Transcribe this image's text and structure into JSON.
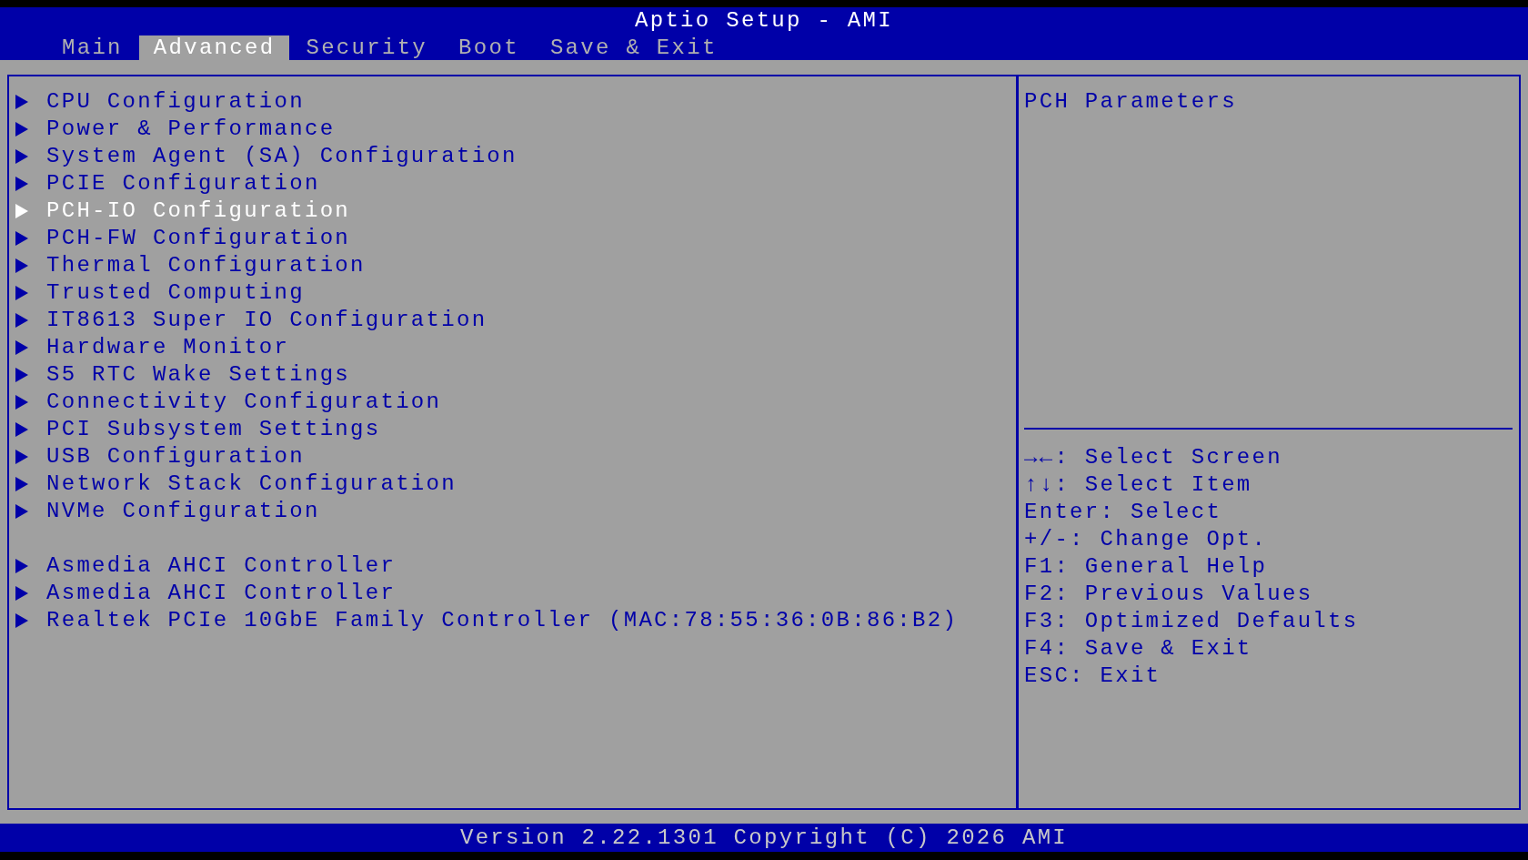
{
  "header": {
    "title": "Aptio Setup - AMI"
  },
  "tabs": [
    {
      "label": "Main",
      "selected": false
    },
    {
      "label": "Advanced",
      "selected": true
    },
    {
      "label": "Security",
      "selected": false
    },
    {
      "label": "Boot",
      "selected": false
    },
    {
      "label": "Save & Exit",
      "selected": false
    }
  ],
  "menu_groups": [
    {
      "items": [
        {
          "label": "CPU Configuration",
          "selected": false
        },
        {
          "label": "Power & Performance",
          "selected": false
        },
        {
          "label": "System Agent (SA) Configuration",
          "selected": false
        },
        {
          "label": "PCIE Configuration",
          "selected": false
        },
        {
          "label": "PCH-IO Configuration",
          "selected": true
        },
        {
          "label": "PCH-FW Configuration",
          "selected": false
        },
        {
          "label": "Thermal Configuration",
          "selected": false
        },
        {
          "label": "Trusted Computing",
          "selected": false
        },
        {
          "label": "IT8613 Super IO Configuration",
          "selected": false
        },
        {
          "label": "Hardware Monitor",
          "selected": false
        },
        {
          "label": "S5 RTC Wake Settings",
          "selected": false
        },
        {
          "label": "Connectivity Configuration",
          "selected": false
        },
        {
          "label": "PCI Subsystem Settings",
          "selected": false
        },
        {
          "label": "USB Configuration",
          "selected": false
        },
        {
          "label": "Network Stack Configuration",
          "selected": false
        },
        {
          "label": "NVMe Configuration",
          "selected": false
        }
      ]
    },
    {
      "items": [
        {
          "label": "Asmedia AHCI Controller",
          "selected": false
        },
        {
          "label": "Asmedia AHCI Controller",
          "selected": false
        },
        {
          "label": "Realtek PCIe 10GbE Family Controller (MAC:78:55:36:0B:86:B2)",
          "selected": false
        }
      ]
    }
  ],
  "help_panel": {
    "description": "PCH Parameters",
    "key_hints": [
      "→←: Select Screen",
      "↑↓: Select Item",
      "Enter: Select",
      "+/-: Change Opt.",
      "F1: General Help",
      "F2: Previous Values",
      "F3: Optimized Defaults",
      "F4: Save & Exit",
      "ESC: Exit"
    ]
  },
  "footer": {
    "text": "Version 2.22.1301 Copyright (C) 2026 AMI"
  }
}
